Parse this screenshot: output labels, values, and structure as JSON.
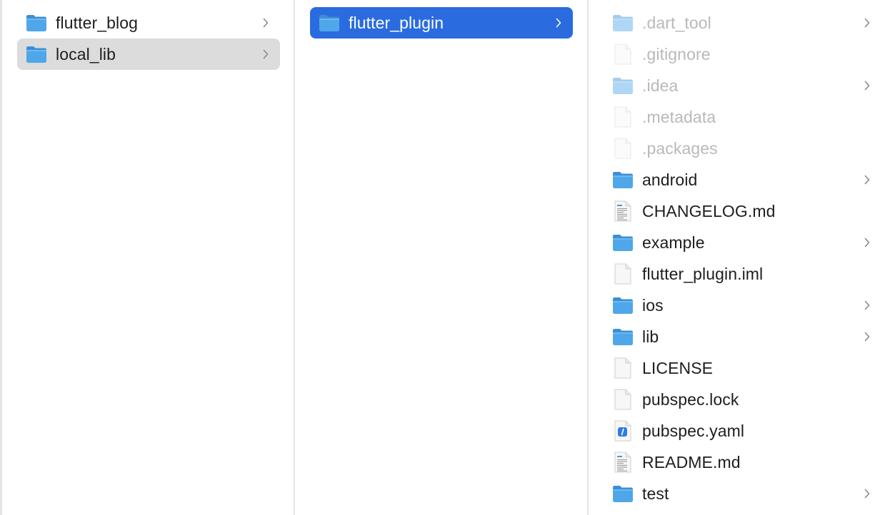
{
  "colors": {
    "selection_active": "#2a6ce0",
    "selection_inactive": "#dcdcdc",
    "folder_fill": "#4fa7e9",
    "folder_tab": "#3b8fd6",
    "text": "#1e1e1e",
    "hidden_text": "#b9b9b9"
  },
  "columns": [
    {
      "items": [
        {
          "name": "flutter_blog",
          "kind": "folder",
          "icon": "folder-icon",
          "expandable": true,
          "state": "normal"
        },
        {
          "name": "local_lib",
          "kind": "folder",
          "icon": "folder-icon",
          "expandable": true,
          "state": "selected-inactive"
        }
      ]
    },
    {
      "items": [
        {
          "name": "flutter_plugin",
          "kind": "folder",
          "icon": "folder-icon",
          "expandable": true,
          "state": "selected-active"
        }
      ]
    },
    {
      "items": [
        {
          "name": ".dart_tool",
          "kind": "folder",
          "icon": "folder-icon",
          "expandable": true,
          "state": "hidden"
        },
        {
          "name": ".gitignore",
          "kind": "file",
          "icon": "blank-document-icon",
          "expandable": false,
          "state": "hidden"
        },
        {
          "name": ".idea",
          "kind": "folder",
          "icon": "folder-icon",
          "expandable": true,
          "state": "hidden"
        },
        {
          "name": ".metadata",
          "kind": "file",
          "icon": "blank-document-icon",
          "expandable": false,
          "state": "hidden"
        },
        {
          "name": ".packages",
          "kind": "file",
          "icon": "blank-document-icon",
          "expandable": false,
          "state": "hidden"
        },
        {
          "name": "android",
          "kind": "folder",
          "icon": "folder-icon",
          "expandable": true,
          "state": "normal"
        },
        {
          "name": "CHANGELOG.md",
          "kind": "file",
          "icon": "text-document-icon",
          "expandable": false,
          "state": "normal"
        },
        {
          "name": "example",
          "kind": "folder",
          "icon": "folder-icon",
          "expandable": true,
          "state": "normal"
        },
        {
          "name": "flutter_plugin.iml",
          "kind": "file",
          "icon": "blank-document-icon",
          "expandable": false,
          "state": "normal"
        },
        {
          "name": "ios",
          "kind": "folder",
          "icon": "folder-icon",
          "expandable": true,
          "state": "normal"
        },
        {
          "name": "lib",
          "kind": "folder",
          "icon": "folder-icon",
          "expandable": true,
          "state": "normal"
        },
        {
          "name": "LICENSE",
          "kind": "file",
          "icon": "blank-document-icon",
          "expandable": false,
          "state": "normal"
        },
        {
          "name": "pubspec.lock",
          "kind": "file",
          "icon": "blank-document-icon",
          "expandable": false,
          "state": "normal"
        },
        {
          "name": "pubspec.yaml",
          "kind": "file",
          "icon": "yaml-document-icon",
          "expandable": false,
          "state": "normal"
        },
        {
          "name": "README.md",
          "kind": "file",
          "icon": "text-document-icon",
          "expandable": false,
          "state": "normal"
        },
        {
          "name": "test",
          "kind": "folder",
          "icon": "folder-icon",
          "expandable": true,
          "state": "normal"
        }
      ]
    }
  ]
}
